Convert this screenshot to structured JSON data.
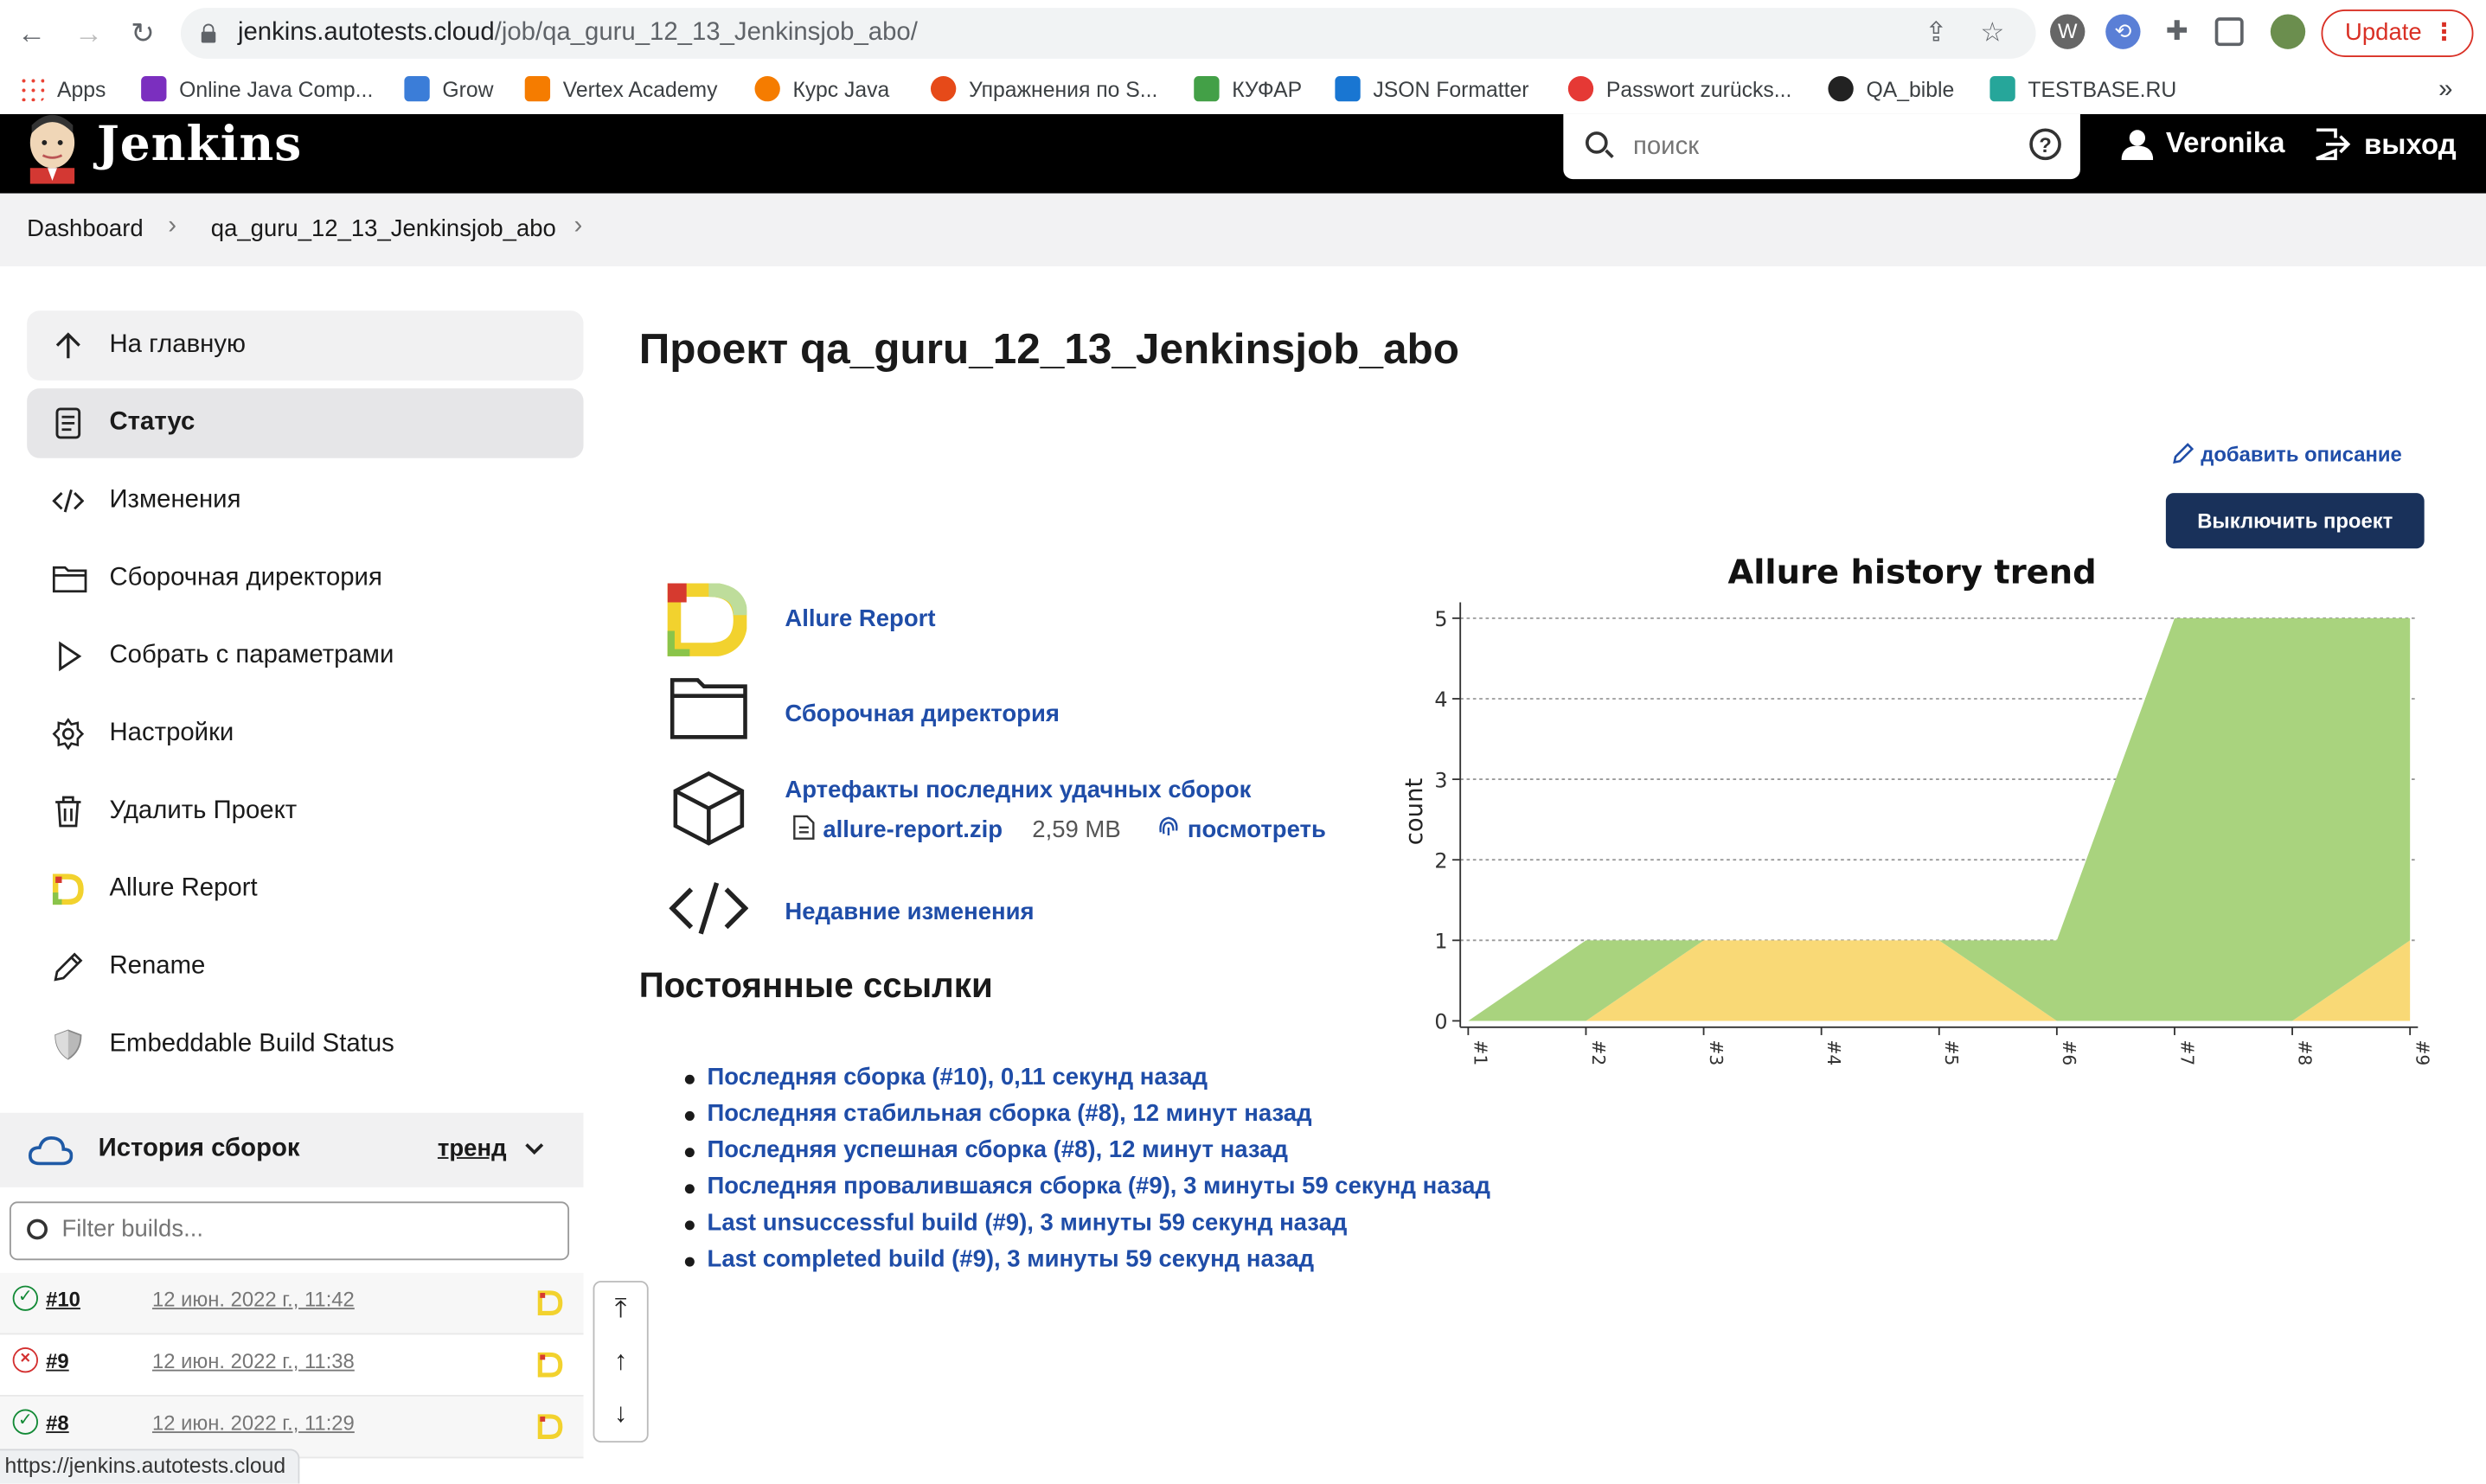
{
  "browser": {
    "url_domain": "jenkins.autotests.cloud",
    "url_path": "/job/qa_guru_12_13_Jenkinsjob_abo/",
    "update_label": "Update",
    "bookmarks": [
      {
        "label": "Apps",
        "color": "#4285f4"
      },
      {
        "label": "Online Java Comp...",
        "color": "#7b2fbf"
      },
      {
        "label": "Grow",
        "color": "#3b7dd8"
      },
      {
        "label": "Vertex Academy",
        "color": "#f57c00"
      },
      {
        "label": "Курс Java",
        "color": "#f57c00"
      },
      {
        "label": "Упражнения по S...",
        "color": "#e64a19"
      },
      {
        "label": "КУФАР",
        "color": "#43a047"
      },
      {
        "label": "JSON Formatter",
        "color": "#1976d2"
      },
      {
        "label": "Passwort zurücks...",
        "color": "#e53935"
      },
      {
        "label": "QA_bible",
        "color": "#222222"
      },
      {
        "label": "TESTBASE.RU",
        "color": "#26a69a"
      }
    ],
    "more": "»",
    "status_url": "https://jenkins.autotests.cloud"
  },
  "header": {
    "title": "Jenkins",
    "search_placeholder": "поиск",
    "help": "?",
    "user": "Veronika",
    "logout": "выход"
  },
  "breadcrumb": [
    "Dashboard",
    "qa_guru_12_13_Jenkinsjob_abo"
  ],
  "sidebar": {
    "items": [
      {
        "label": "На главную",
        "icon": "arrow-up-icon"
      },
      {
        "label": "Статус",
        "icon": "document-icon"
      },
      {
        "label": "Изменения",
        "icon": "code-icon"
      },
      {
        "label": "Сборочная директория",
        "icon": "folder-icon"
      },
      {
        "label": "Собрать с параметрами",
        "icon": "play-icon"
      },
      {
        "label": "Настройки",
        "icon": "gear-icon"
      },
      {
        "label": "Удалить Проект",
        "icon": "trash-icon"
      },
      {
        "label": "Allure Report",
        "icon": "allure-icon"
      },
      {
        "label": "Rename",
        "icon": "pencil-icon"
      },
      {
        "label": "Embeddable Build Status",
        "icon": "shield-icon"
      }
    ],
    "history_title": "История сборок",
    "trend_label": "тренд",
    "filter_placeholder": "Filter builds...",
    "builds": [
      {
        "num": "#10",
        "date": "12 июн. 2022 г., 11:42",
        "status": "success"
      },
      {
        "num": "#9",
        "date": "12 июн. 2022 г., 11:38",
        "status": "failed"
      },
      {
        "num": "#8",
        "date": "12 июн. 2022 г., 11:29",
        "status": "success"
      }
    ]
  },
  "main": {
    "title": "Проект qa_guru_12_13_Jenkinsjob_abo",
    "add_description": "добавить описание",
    "disable_button": "Выключить проект",
    "links": {
      "allure": "Allure Report",
      "workspace": "Сборочная директория",
      "artifacts": "Артефакты последних удачных сборок",
      "artifact_file": "allure-report.zip",
      "artifact_size": "2,59 MB",
      "artifact_view": "посмотреть",
      "changes": "Недавние изменения"
    },
    "permalinks_title": "Постоянные ссылки",
    "permalinks": [
      "Последняя сборка (#10), 0,11 секунд назад",
      "Последняя стабильная сборка (#8), 12 минут назад",
      "Последняя успешная сборка (#8), 12 минут назад",
      "Последняя провалившаяся сборка (#9), 3 минуты 59 секунд назад",
      "Last unsuccessful build (#9), 3 минуты 59 секунд назад",
      "Last completed build (#9), 3 минуты 59 секунд назад"
    ]
  },
  "chart_data": {
    "type": "area",
    "title": "Allure history trend",
    "xlabel": "",
    "ylabel": "count",
    "categories": [
      "#1",
      "#2",
      "#3",
      "#4",
      "#5",
      "#6",
      "#7",
      "#8",
      "#9"
    ],
    "ylim": [
      0,
      5
    ],
    "yticks": [
      0,
      1,
      2,
      3,
      4,
      5
    ],
    "grid": true,
    "stacked": true,
    "series": [
      {
        "values": [
          0,
          0,
          1,
          1,
          1,
          0,
          0,
          0,
          1
        ],
        "color": "#f9d976"
      },
      {
        "values": [
          0,
          1,
          0,
          0,
          0,
          1,
          5,
          5,
          4
        ],
        "color": "#a9d37e"
      }
    ]
  },
  "colors": {
    "link": "#1f4da8",
    "disable_button": "#19315a",
    "success": "#138a36",
    "failure": "#d32f2f"
  }
}
